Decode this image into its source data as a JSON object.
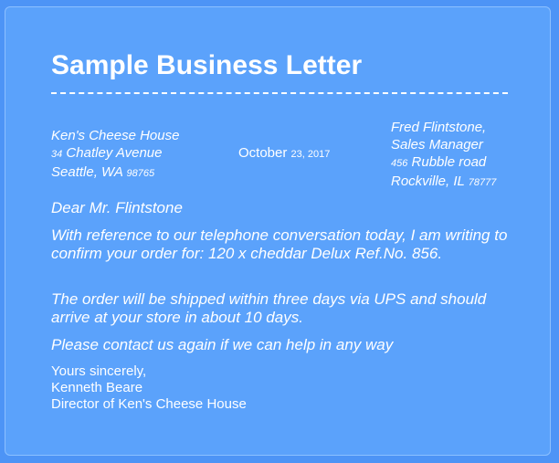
{
  "letter": {
    "title": "Sample Business Letter",
    "sender": {
      "company": "Ken's Cheese House",
      "street_number": "34",
      "street_name": "Chatley Avenue",
      "city_state": "Seattle, WA",
      "zip": "98765"
    },
    "date": {
      "month": "October",
      "day_year": "23, 2017"
    },
    "recipient": {
      "name": "Fred Flintstone,",
      "title": "Sales Manager",
      "street_number": "456",
      "street_name": "Rubble road",
      "city_state": "Rockville, IL",
      "zip": "78777"
    },
    "salutation": "Dear Mr. Flintstone",
    "paragraphs": [
      "With reference to our telephone conversation today, I am writing to confirm your order for: 120 x cheddar Delux Ref.No. 856.",
      "The order will be shipped within three days via UPS and should arrive at your store in about 10 days.",
      "Please contact us again if we can help in any way"
    ],
    "closing": {
      "sign_off": "Yours sincerely,",
      "signer_name": "Kenneth Beare",
      "signer_title": "Director of Ken's Cheese House"
    }
  }
}
